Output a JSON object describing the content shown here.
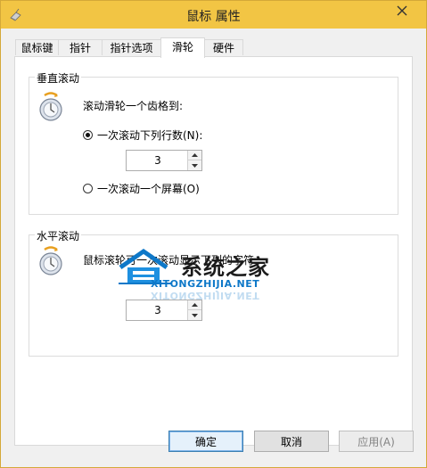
{
  "window": {
    "title": "鼠标 属性",
    "accent_color": "#f2c544",
    "close_icon": "close-icon"
  },
  "tabs": [
    {
      "label": "鼠标键",
      "active": false
    },
    {
      "label": "指针",
      "active": false
    },
    {
      "label": "指针选项",
      "active": false
    },
    {
      "label": "滑轮",
      "active": true
    },
    {
      "label": "硬件",
      "active": false
    }
  ],
  "vertical": {
    "group_label": "垂直滚动",
    "description": "滚动滑轮一个齿格到:",
    "option_lines_label": "一次滚动下列行数(N):",
    "option_lines_checked": true,
    "lines_value": "3",
    "option_screen_label": "一次滚动一个屏幕(O)",
    "option_screen_checked": false
  },
  "horizontal": {
    "group_label": "水平滚动",
    "description": "鼠标滚轮可一次滚动显示下列的字符",
    "chars_value": "3"
  },
  "watermark": {
    "cn": "系统之家",
    "en": "XITONGZHIJIA.NET"
  },
  "buttons": {
    "ok": "确定",
    "cancel": "取消",
    "apply": "应用(A)"
  }
}
